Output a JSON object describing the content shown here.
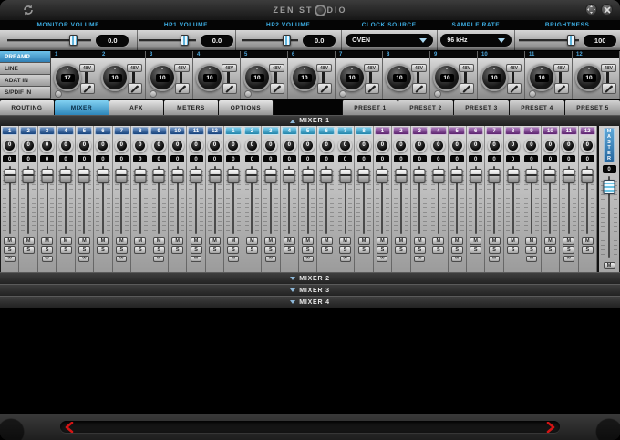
{
  "window": {
    "title_left": "ZEN ST",
    "title_right": "DIO",
    "icons": {
      "sync": "circular-arrows",
      "resize": "four-way-arrows",
      "close": "x"
    }
  },
  "header": {
    "monitor": {
      "label": "MONITOR VOLUME",
      "value": "0.0"
    },
    "hp1": {
      "label": "HP1 VOLUME",
      "value": "0.0"
    },
    "hp2": {
      "label": "HP2 VOLUME",
      "value": "0.0"
    },
    "clock_source": {
      "label": "CLOCK SOURCE",
      "value": "OVEN"
    },
    "sample_rate": {
      "label": "SAMPLE RATE",
      "value": "96 kHz"
    },
    "brightness": {
      "label": "BRIGHTNESS",
      "value": "100"
    }
  },
  "preamp": {
    "tabs": [
      {
        "label": "PREAMP",
        "active": true
      },
      {
        "label": "LINE",
        "active": false
      },
      {
        "label": "ADAT IN",
        "active": false
      },
      {
        "label": "S/PDIF IN",
        "active": false
      }
    ],
    "phantom_label": "48V",
    "channels": [
      {
        "num": "1",
        "gain": "17"
      },
      {
        "num": "2",
        "gain": "10"
      },
      {
        "num": "3",
        "gain": "10"
      },
      {
        "num": "4",
        "gain": "10"
      },
      {
        "num": "5",
        "gain": "10"
      },
      {
        "num": "6",
        "gain": "10"
      },
      {
        "num": "7",
        "gain": "10"
      },
      {
        "num": "8",
        "gain": "10"
      },
      {
        "num": "9",
        "gain": "10"
      },
      {
        "num": "10",
        "gain": "10"
      },
      {
        "num": "11",
        "gain": "10"
      },
      {
        "num": "12",
        "gain": "10"
      }
    ]
  },
  "main_tabs": [
    {
      "label": "ROUTING",
      "active": false
    },
    {
      "label": "MIXER",
      "active": true
    },
    {
      "label": "AFX",
      "active": false
    },
    {
      "label": "METERS",
      "active": false
    },
    {
      "label": "OPTIONS",
      "active": false
    }
  ],
  "presets": [
    "PRESET 1",
    "PRESET 2",
    "PRESET 3",
    "PRESET 4",
    "PRESET 5"
  ],
  "mixer": {
    "title": "MIXER 1",
    "collapsed": [
      "MIXER 2",
      "MIXER 3",
      "MIXER 4"
    ],
    "pan": "0",
    "level": "0",
    "mute": "M",
    "solo": "S",
    "link_glyph": "∞",
    "groups": [
      {
        "name": "group-blue",
        "color": "#1e59a5",
        "count": 12
      },
      {
        "name": "group-cyan",
        "color": "#2fb0e2",
        "count": 8
      },
      {
        "name": "group-purple",
        "color": "#7b2f94",
        "count": 12
      }
    ],
    "master": {
      "label": "MASTER",
      "value": "0",
      "mute": "M"
    }
  },
  "colors": {
    "accent_cyan": "#3eb1e8",
    "active_tab_blue": "#2d86ba",
    "scroll_arrow_red": "#d41414"
  }
}
